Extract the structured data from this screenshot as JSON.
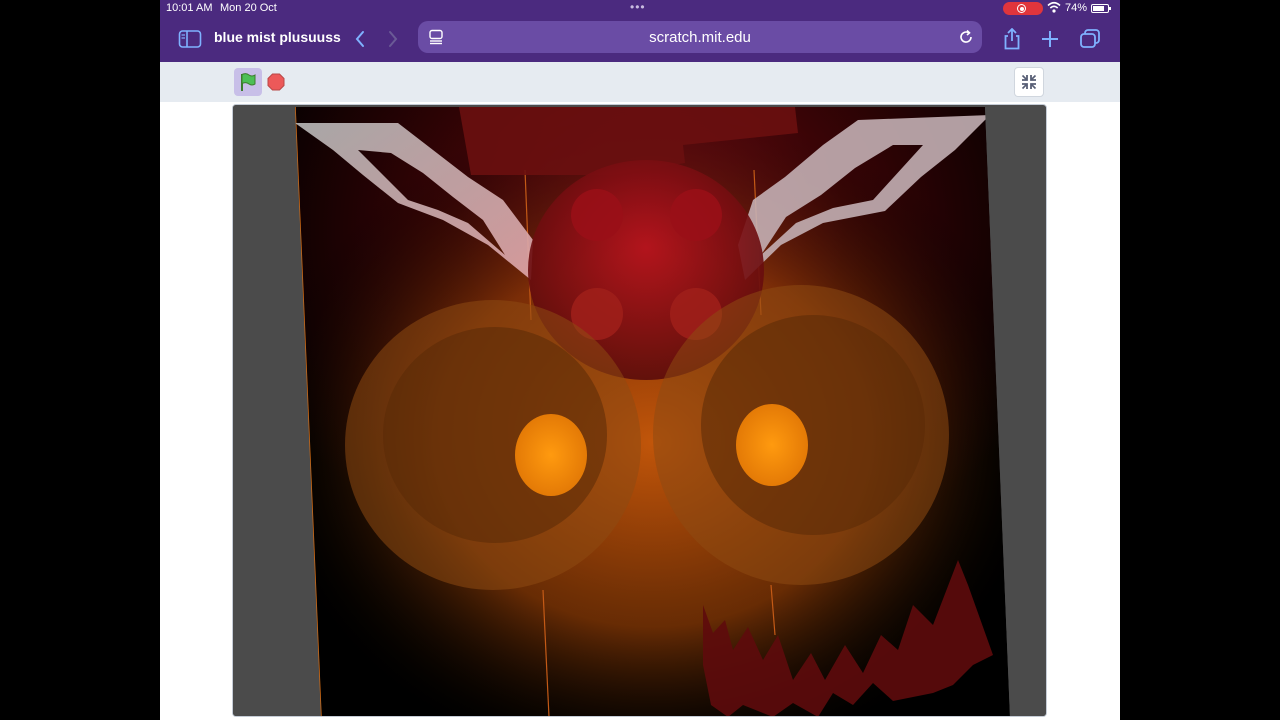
{
  "status_bar": {
    "time": "10:01 AM",
    "date": "Mon 20 Oct",
    "battery_pct": "74%",
    "battery_level": 0.74
  },
  "browser": {
    "tab_title": "blue mist plusuuss",
    "url": "scratch.mit.edu",
    "chrome_color": "#4b2a7f",
    "urlbar_color": "#6a4ca5"
  },
  "scratch": {
    "green_flag_active": true,
    "stage_background": "#000000"
  },
  "icons": {
    "sidebar": "sidebar-icon",
    "back": "chevron-left-icon",
    "forward": "chevron-right-icon",
    "tab_overview": "tab-overview-icon",
    "reload": "reload-icon",
    "share": "share-icon",
    "new_tab": "plus-icon",
    "tabs": "tabs-icon",
    "green_flag": "green-flag-icon",
    "stop": "stop-icon",
    "exit_fullscreen": "exit-fullscreen-icon"
  }
}
